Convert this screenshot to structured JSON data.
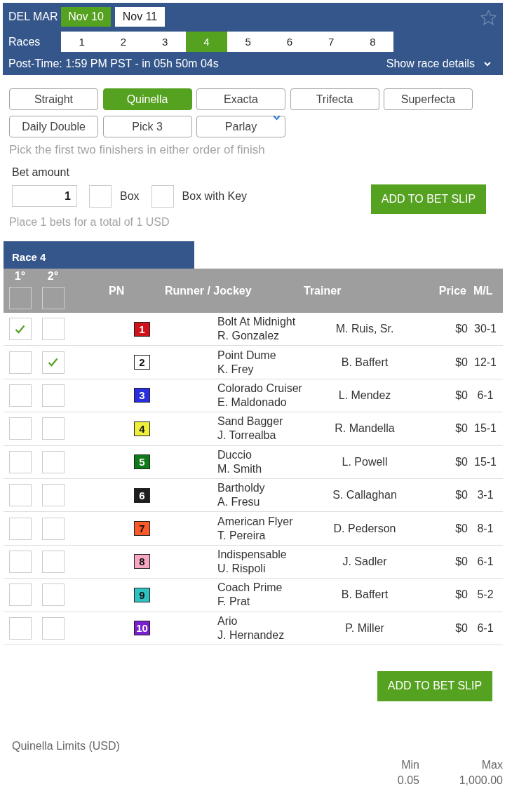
{
  "header": {
    "track": "DEL MAR",
    "dates": [
      {
        "label": "Nov 10",
        "selected": true
      },
      {
        "label": "Nov 11",
        "selected": false
      }
    ],
    "favorite": false,
    "races_label": "Races",
    "races": [
      {
        "label": "1",
        "selected": false
      },
      {
        "label": "2",
        "selected": false
      },
      {
        "label": "3",
        "selected": false
      },
      {
        "label": "4",
        "selected": true
      },
      {
        "label": "5",
        "selected": false
      },
      {
        "label": "6",
        "selected": false
      },
      {
        "label": "7",
        "selected": false
      },
      {
        "label": "8",
        "selected": false
      }
    ],
    "post_time": "Post-Time: 1:59 PM PST - in 05h 50m 04s",
    "details_toggle": {
      "label": "Show race details",
      "expanded": false
    }
  },
  "bet_types": [
    {
      "label": "Straight",
      "kind": "button",
      "selected": false
    },
    {
      "label": "Quinella",
      "kind": "button",
      "selected": true
    },
    {
      "label": "Exacta",
      "kind": "button",
      "selected": false
    },
    {
      "label": "Trifecta",
      "kind": "button",
      "selected": false
    },
    {
      "label": "Superfecta",
      "kind": "button",
      "selected": false
    },
    {
      "label": "Daily Double",
      "kind": "button",
      "selected": false
    },
    {
      "label": "Pick 3",
      "kind": "button",
      "selected": false
    },
    {
      "label": "Parlay",
      "kind": "dropdown",
      "selected": false
    }
  ],
  "description": "Pick the first two finishers in either order of finish",
  "bet_form": {
    "amount_label": "Bet amount",
    "amount": "1",
    "options": [
      {
        "label": "Box",
        "checked": false
      },
      {
        "label": "Box with Key",
        "checked": false
      }
    ],
    "add_button": "ADD TO BET SLIP",
    "summary": "Place 1 bets for a total of 1 USD"
  },
  "race_table": {
    "tab": "Race 4",
    "position_columns": [
      {
        "label": "1°",
        "checked": false
      },
      {
        "label": "2°",
        "checked": false
      }
    ],
    "columns": [
      "PN",
      "Runner / Jockey",
      "Trainer",
      "Price",
      "M/L"
    ],
    "rows": [
      {
        "pn": "1",
        "color": "#d0121a",
        "runner": "Bolt At Midnight",
        "jockey": "R. Gonzalez",
        "trainer": "M. Ruis, Sr.",
        "price": "$0",
        "ml": "30-1",
        "picks": [
          {
            "checked": true
          },
          {
            "checked": false
          }
        ]
      },
      {
        "pn": "2",
        "color": "#ffffff",
        "runner": "Point Dume",
        "jockey": "K. Frey",
        "trainer": "B. Baffert",
        "price": "$0",
        "ml": "12-1",
        "picks": [
          {
            "checked": false
          },
          {
            "checked": true
          }
        ]
      },
      {
        "pn": "3",
        "color": "#2b2ee0",
        "runner": "Colorado Cruiser",
        "jockey": "E. Maldonado",
        "trainer": "L. Mendez",
        "price": "$0",
        "ml": "6-1",
        "picks": [
          {
            "checked": false
          },
          {
            "checked": false
          }
        ]
      },
      {
        "pn": "4",
        "color": "#eeee3c",
        "runner": "Sand Bagger",
        "jockey": "J. Torrealba",
        "trainer": "R. Mandella",
        "price": "$0",
        "ml": "15-1",
        "picks": [
          {
            "checked": false
          },
          {
            "checked": false
          }
        ]
      },
      {
        "pn": "5",
        "color": "#0e7a1a",
        "runner": "Duccio",
        "jockey": "M. Smith",
        "trainer": "L. Powell",
        "price": "$0",
        "ml": "15-1",
        "picks": [
          {
            "checked": false
          },
          {
            "checked": false
          }
        ]
      },
      {
        "pn": "6",
        "color": "#1e1e1e",
        "runner": "Bartholdy",
        "jockey": "A. Fresu",
        "trainer": "S. Callaghan",
        "price": "$0",
        "ml": "3-1",
        "picks": [
          {
            "checked": false
          },
          {
            "checked": false
          }
        ]
      },
      {
        "pn": "7",
        "color": "#fb5a2a",
        "runner": "American Flyer",
        "jockey": "T. Pereira",
        "trainer": "D. Pederson",
        "price": "$0",
        "ml": "8-1",
        "picks": [
          {
            "checked": false
          },
          {
            "checked": false
          }
        ]
      },
      {
        "pn": "8",
        "color": "#f6a8c2",
        "runner": "Indispensable",
        "jockey": "U. Rispoli",
        "trainer": "J. Sadler",
        "price": "$0",
        "ml": "6-1",
        "picks": [
          {
            "checked": false
          },
          {
            "checked": false
          }
        ]
      },
      {
        "pn": "9",
        "color": "#30c2c2",
        "runner": "Coach Prime",
        "jockey": "F. Prat",
        "trainer": "B. Baffert",
        "price": "$0",
        "ml": "5-2",
        "picks": [
          {
            "checked": false
          },
          {
            "checked": false
          }
        ]
      },
      {
        "pn": "10",
        "color": "#7a1fcf",
        "runner": "Ario",
        "jockey": "J. Hernandez",
        "trainer": "P. Miller",
        "price": "$0",
        "ml": "6-1",
        "picks": [
          {
            "checked": false
          },
          {
            "checked": false
          }
        ]
      }
    ]
  },
  "add_button": "ADD TO BET SLIP",
  "limits": {
    "title": "Quinella Limits (USD)",
    "columns": [
      {
        "label": "Min",
        "value": "0.05"
      },
      {
        "label": "Max",
        "value": "1,000.00"
      }
    ]
  }
}
